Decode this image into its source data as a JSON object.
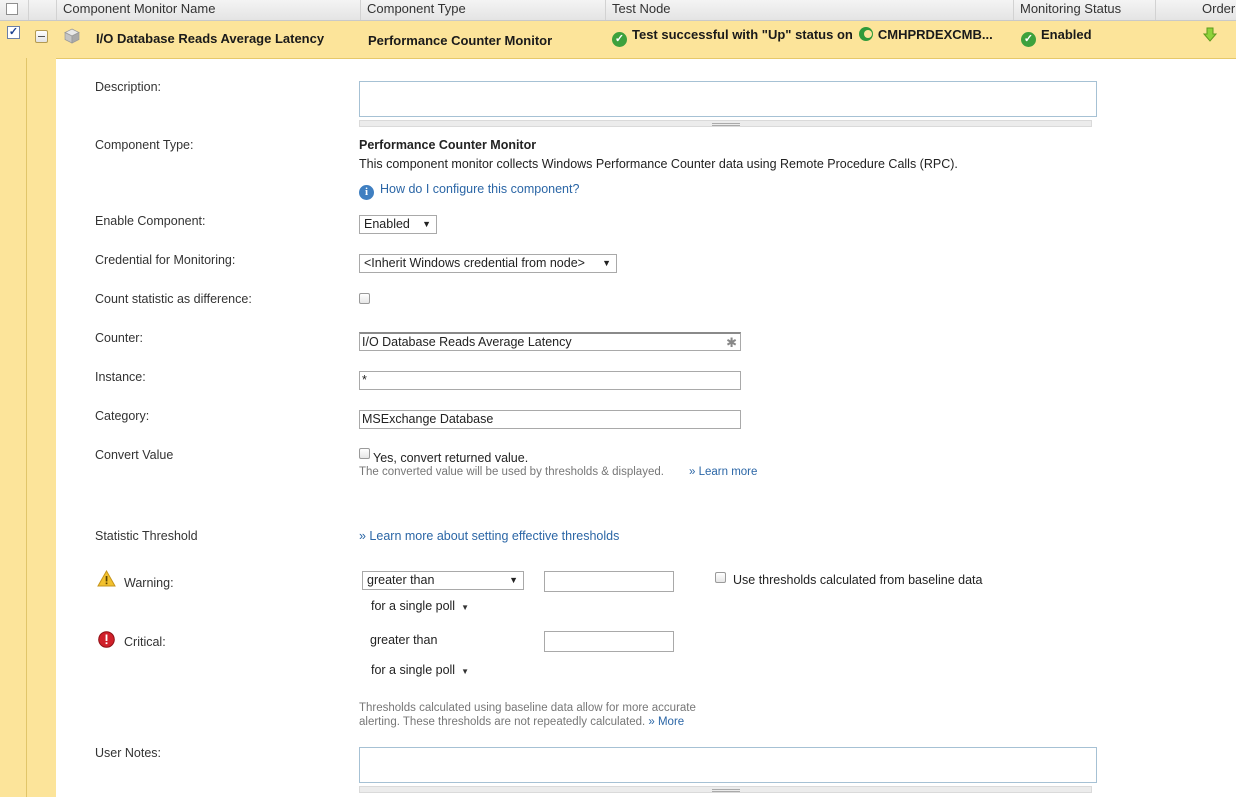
{
  "header": {
    "columns": [
      "Component Monitor Name",
      "Component Type",
      "Test Node",
      "Monitoring Status",
      "Order"
    ]
  },
  "row": {
    "checked_mark": "✓",
    "name": "I/O Database Reads Average Latency",
    "type": "Performance Counter Monitor",
    "test_result": "Test successful with \"Up\" status on",
    "test_node": "CMHPRDEXCMB...",
    "status": "Enabled",
    "ok_glyph": "✓",
    "order_icon": "down-arrow-icon"
  },
  "form": {
    "description_label": "Description:",
    "description_value": "",
    "component_type_label": "Component Type:",
    "component_type_name": "Performance Counter Monitor",
    "component_type_desc": "This component monitor collects Windows Performance Counter data using Remote Procedure Calls (RPC).",
    "info_glyph": "i",
    "how_to_link": "How do I configure this component?",
    "enable_label": "Enable Component:",
    "enable_value": "Enabled",
    "credential_label": "Credential for Monitoring:",
    "credential_value": "<Inherit Windows credential from node>",
    "count_stat_label": "Count statistic as difference:",
    "counter_label": "Counter:",
    "counter_value": "I/O Database Reads Average Latency",
    "required_glyph": "✱",
    "instance_label": "Instance:",
    "instance_value": "*",
    "category_label": "Category:",
    "category_value": "MSExchange Database",
    "convert_label": "Convert Value",
    "convert_checkbox_text": "Yes, convert returned value.",
    "convert_note": "The converted value will be used by thresholds & displayed.",
    "learn_more": "» Learn more",
    "stat_threshold_label": "Statistic Threshold",
    "threshold_link": "» Learn more about setting effective thresholds",
    "warning_label": "Warning:",
    "warning_operator": "greater than",
    "warning_value": "",
    "baseline_label": "Use thresholds calculated from baseline data",
    "warning_poll": "for a single poll",
    "critical_label": "Critical:",
    "critical_operator": "greater than",
    "critical_value": "",
    "critical_poll": "for a single poll",
    "baseline_note_1": "Thresholds calculated using baseline data allow for more accurate",
    "baseline_note_2": "alerting. These thresholds are not repeatedly calculated.",
    "more_link": "» More",
    "user_notes_label": "User Notes:",
    "user_notes_value": ""
  },
  "colors": {
    "selected_row": "#fce49a",
    "link": "#2b66a6",
    "ok_green": "#3da13d"
  }
}
